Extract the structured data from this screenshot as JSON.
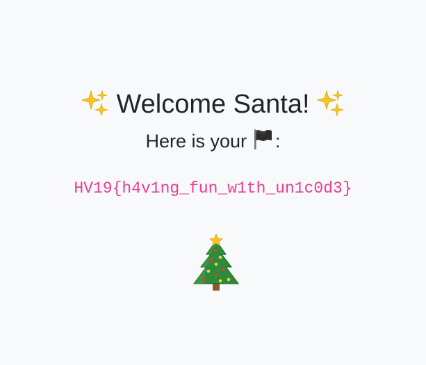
{
  "header": {
    "title": "Welcome Santa!",
    "left_icon": "sparkles-icon",
    "right_icon": "sparkles-icon"
  },
  "message": {
    "prefix": "Here is your",
    "icon": "black-flag-icon",
    "suffix": ":"
  },
  "flag_code": {
    "value": "HV19{h4v1ng_fun_w1th_un1c0d3}",
    "color": "#e83e8c"
  },
  "footer": {
    "icon": "christmas-tree-icon"
  },
  "colors": {
    "background": "#f8f9fa",
    "text": "#212529",
    "code": "#e83e8c"
  }
}
